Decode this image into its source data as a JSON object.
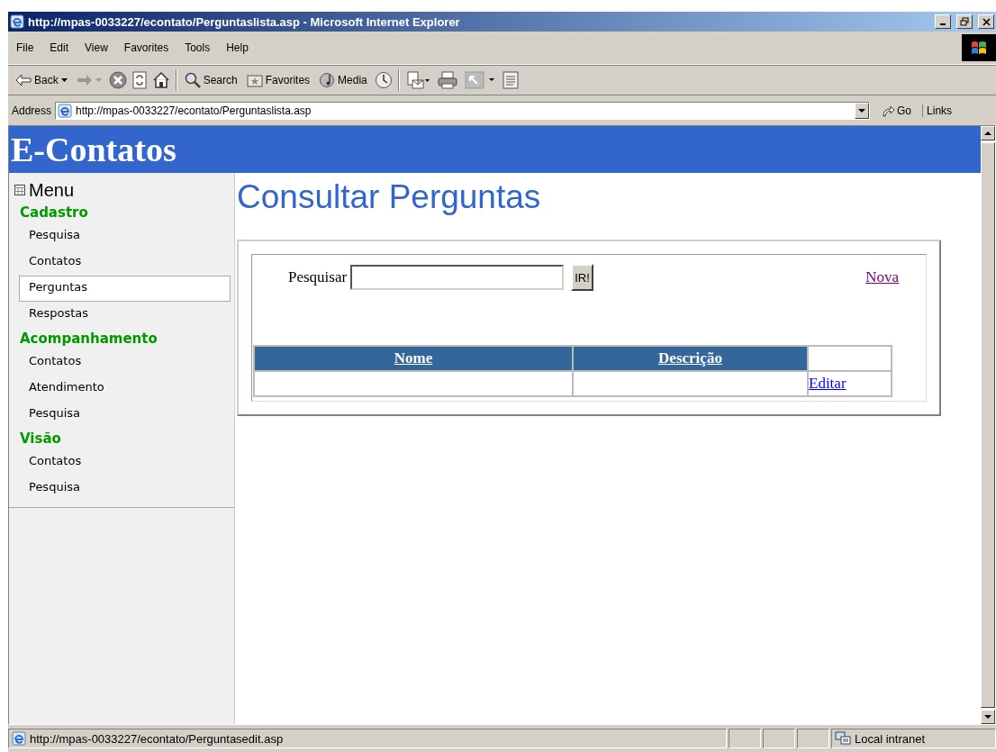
{
  "window": {
    "title": "http://mpas-0033227/econtato/Perguntaslista.asp - Microsoft Internet Explorer"
  },
  "menu_bar": [
    "File",
    "Edit",
    "View",
    "Favorites",
    "Tools",
    "Help"
  ],
  "toolbar": {
    "back": "Back",
    "search": "Search",
    "favorites": "Favorites",
    "media": "Media"
  },
  "address_bar": {
    "label": "Address",
    "value": "http://mpas-0033227/econtato/Perguntaslista.asp",
    "go": "Go",
    "links": "Links"
  },
  "page": {
    "site_title": "E-Contatos",
    "sidebar": {
      "title": "Menu",
      "sections": [
        {
          "title": "Cadastro",
          "items": [
            {
              "label": "Pesquisa",
              "selected": false
            },
            {
              "label": "Contatos",
              "selected": false
            },
            {
              "label": "Perguntas",
              "selected": true
            },
            {
              "label": "Respostas",
              "selected": false
            }
          ]
        },
        {
          "title": "Acompanhamento",
          "items": [
            {
              "label": "Contatos",
              "selected": false
            },
            {
              "label": "Atendimento",
              "selected": false
            },
            {
              "label": "Pesquisa",
              "selected": false
            }
          ]
        },
        {
          "title": "Visão",
          "items": [
            {
              "label": "Contatos",
              "selected": false
            },
            {
              "label": "Pesquisa",
              "selected": false
            }
          ]
        }
      ]
    },
    "heading": "Consultar Perguntas",
    "search": {
      "label": "Pesquisar",
      "button": "IR!"
    },
    "new_link": "Nova",
    "table": {
      "columns": [
        "Nome",
        "Descrição"
      ],
      "rows": [
        {
          "action": "Editar"
        }
      ]
    }
  },
  "status_bar": {
    "text": "http://mpas-0033227/econtato/Perguntasedit.asp",
    "zone": "Local intranet"
  }
}
